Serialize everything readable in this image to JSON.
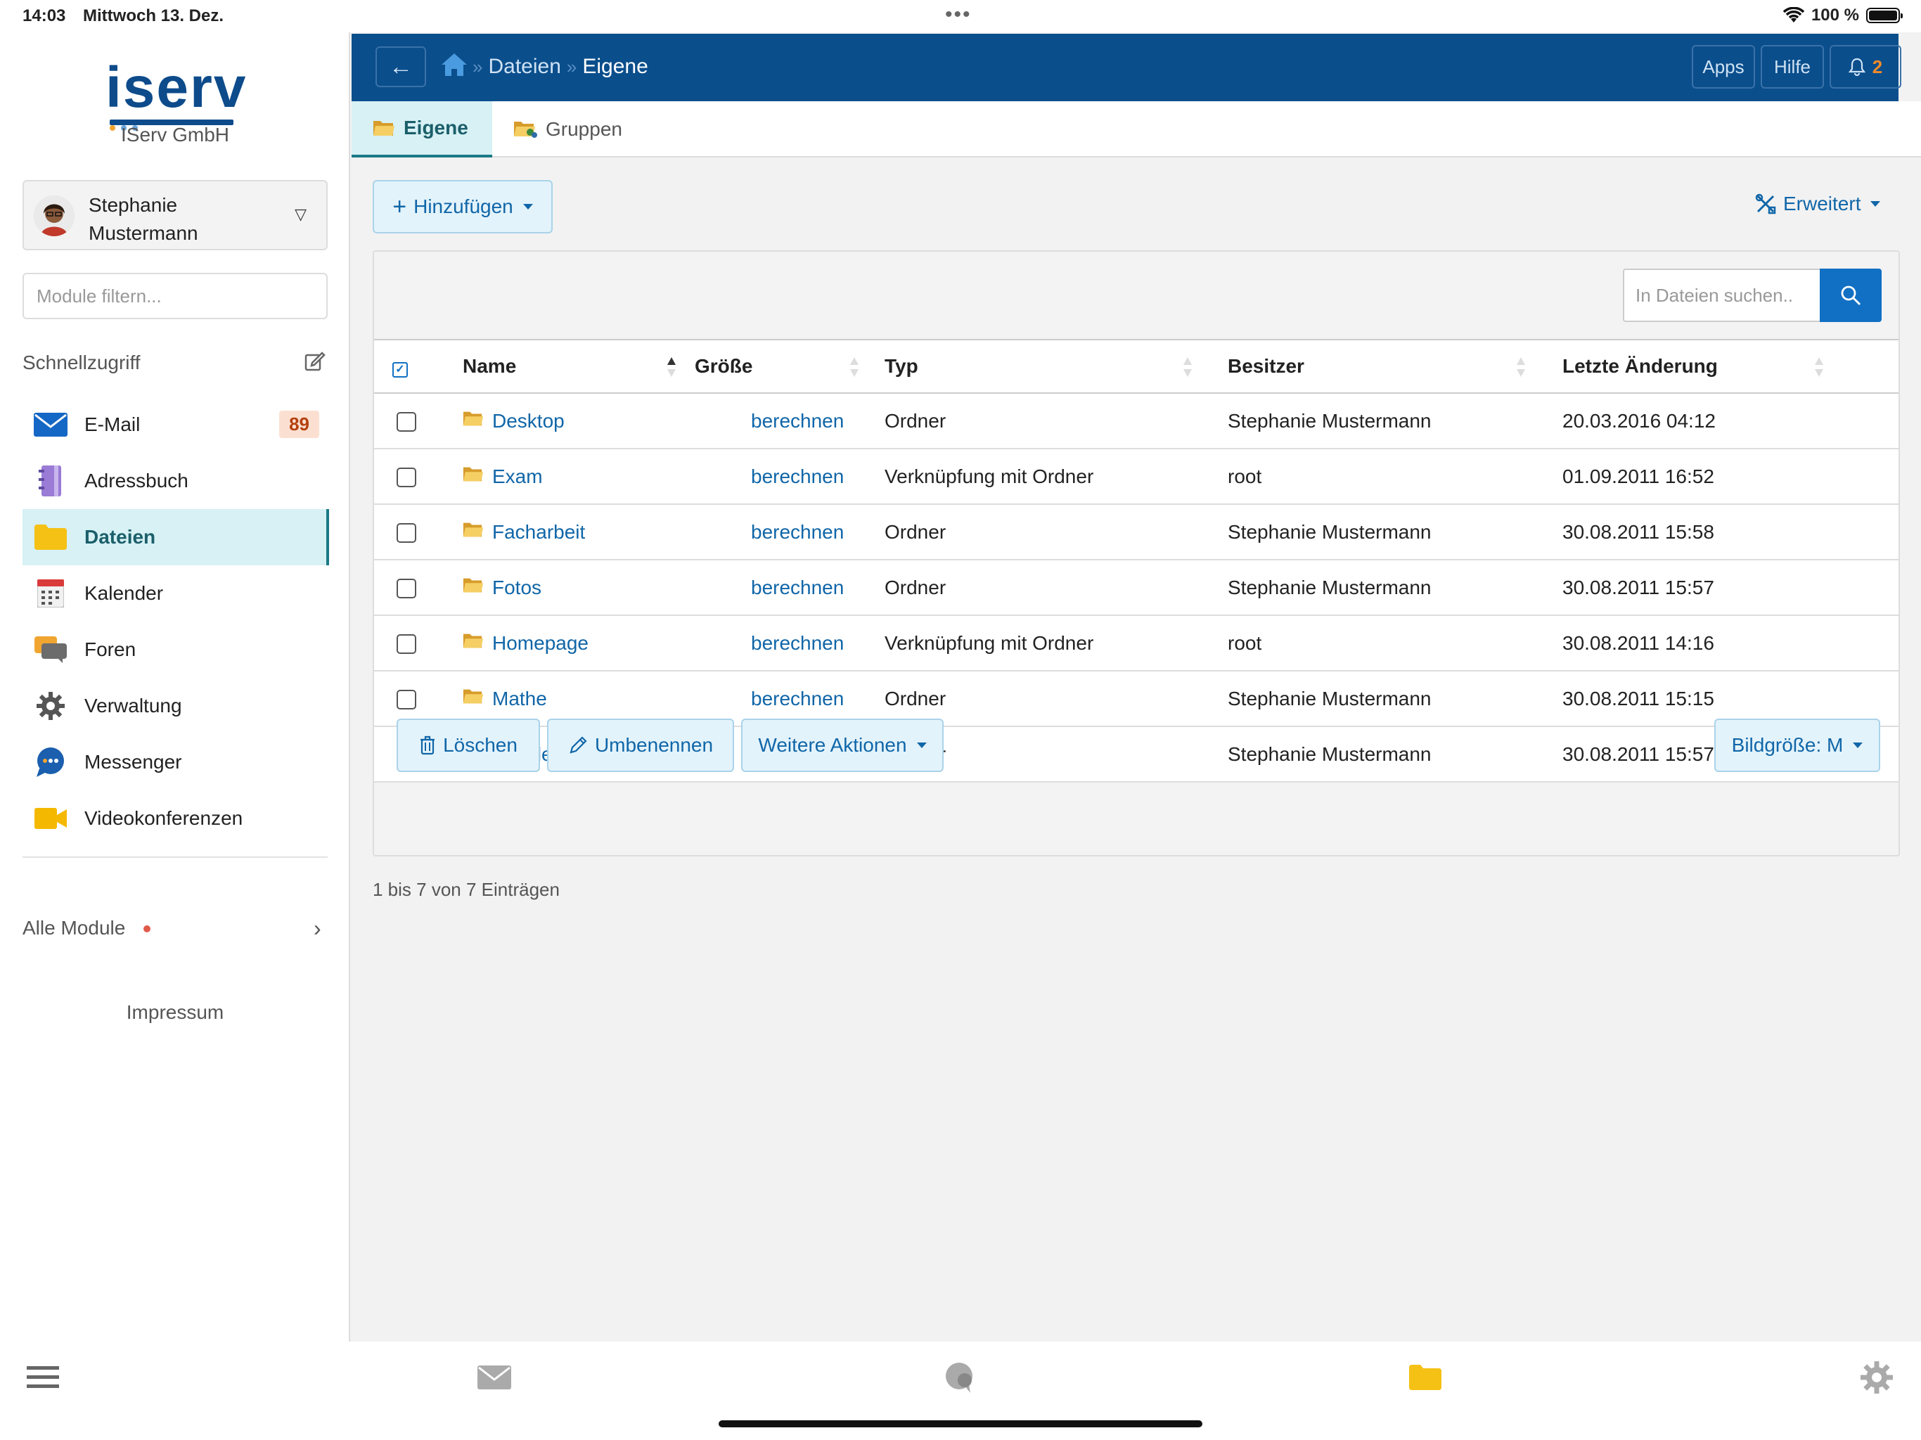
{
  "status_bar": {
    "time": "14:03",
    "date": "Mittwoch 13. Dez.",
    "battery": "100 %"
  },
  "sidebar": {
    "logo_text": "iserv",
    "org_name": "IServ GmbH",
    "user_first": "Stephanie",
    "user_last": "Mustermann",
    "filter_placeholder": "Module filtern...",
    "quick_access_title": "Schnellzugriff",
    "items": [
      {
        "label": "E-Mail",
        "icon": "mail-icon",
        "badge": "89"
      },
      {
        "label": "Adressbuch",
        "icon": "address-book-icon"
      },
      {
        "label": "Dateien",
        "icon": "folder-icon",
        "active": true
      },
      {
        "label": "Kalender",
        "icon": "calendar-icon"
      },
      {
        "label": "Foren",
        "icon": "forum-icon"
      },
      {
        "label": "Verwaltung",
        "icon": "gear-icon"
      },
      {
        "label": "Messenger",
        "icon": "chat-bubble-icon"
      },
      {
        "label": "Videokonferenzen",
        "icon": "video-camera-icon"
      }
    ],
    "all_modules": "Alle Module",
    "impressum": "Impressum"
  },
  "topbar": {
    "breadcrumb": [
      "Dateien",
      "Eigene"
    ],
    "apps_label": "Apps",
    "help_label": "Hilfe",
    "notification_count": "2"
  },
  "tabs": [
    {
      "label": "Eigene",
      "active": true
    },
    {
      "label": "Gruppen",
      "active": false
    }
  ],
  "toolbar": {
    "add_label": "Hinzufügen",
    "advanced_label": "Erweitert",
    "search_placeholder": "In Dateien suchen.."
  },
  "table": {
    "columns": [
      "Name",
      "Größe",
      "Typ",
      "Besitzer",
      "Letzte Änderung"
    ],
    "rows": [
      {
        "name": "Desktop",
        "size": "berechnen",
        "type": "Ordner",
        "owner": "Stephanie Mustermann",
        "modified": "20.03.2016 04:12"
      },
      {
        "name": "Exam",
        "size": "berechnen",
        "type": "Verknüpfung mit Ordner",
        "owner": "root",
        "modified": "01.09.2011 16:52"
      },
      {
        "name": "Facharbeit",
        "size": "berechnen",
        "type": "Ordner",
        "owner": "Stephanie Mustermann",
        "modified": "30.08.2011 15:58"
      },
      {
        "name": "Fotos",
        "size": "berechnen",
        "type": "Ordner",
        "owner": "Stephanie Mustermann",
        "modified": "30.08.2011 15:57"
      },
      {
        "name": "Homepage",
        "size": "berechnen",
        "type": "Verknüpfung mit Ordner",
        "owner": "root",
        "modified": "30.08.2011 14:16"
      },
      {
        "name": "Mathe",
        "size": "berechnen",
        "type": "Ordner",
        "owner": "Stephanie Mustermann",
        "modified": "30.08.2011 15:15"
      },
      {
        "name": "Schülerrat",
        "size": "berechnen",
        "type": "Ordner",
        "owner": "Stephanie Mustermann",
        "modified": "30.08.2011 15:57"
      }
    ]
  },
  "actions": {
    "delete_label": "Löschen",
    "rename_label": "Umbenennen",
    "more_label": "Weitere Aktionen",
    "image_size_label": "Bildgröße: M"
  },
  "pagination_text": "1 bis 7 von 7 Einträgen",
  "colors": {
    "brand": "#0a4e8c",
    "accent": "#1066a8",
    "active_bg": "#d7f1f5",
    "badge_text": "#b5410f"
  }
}
